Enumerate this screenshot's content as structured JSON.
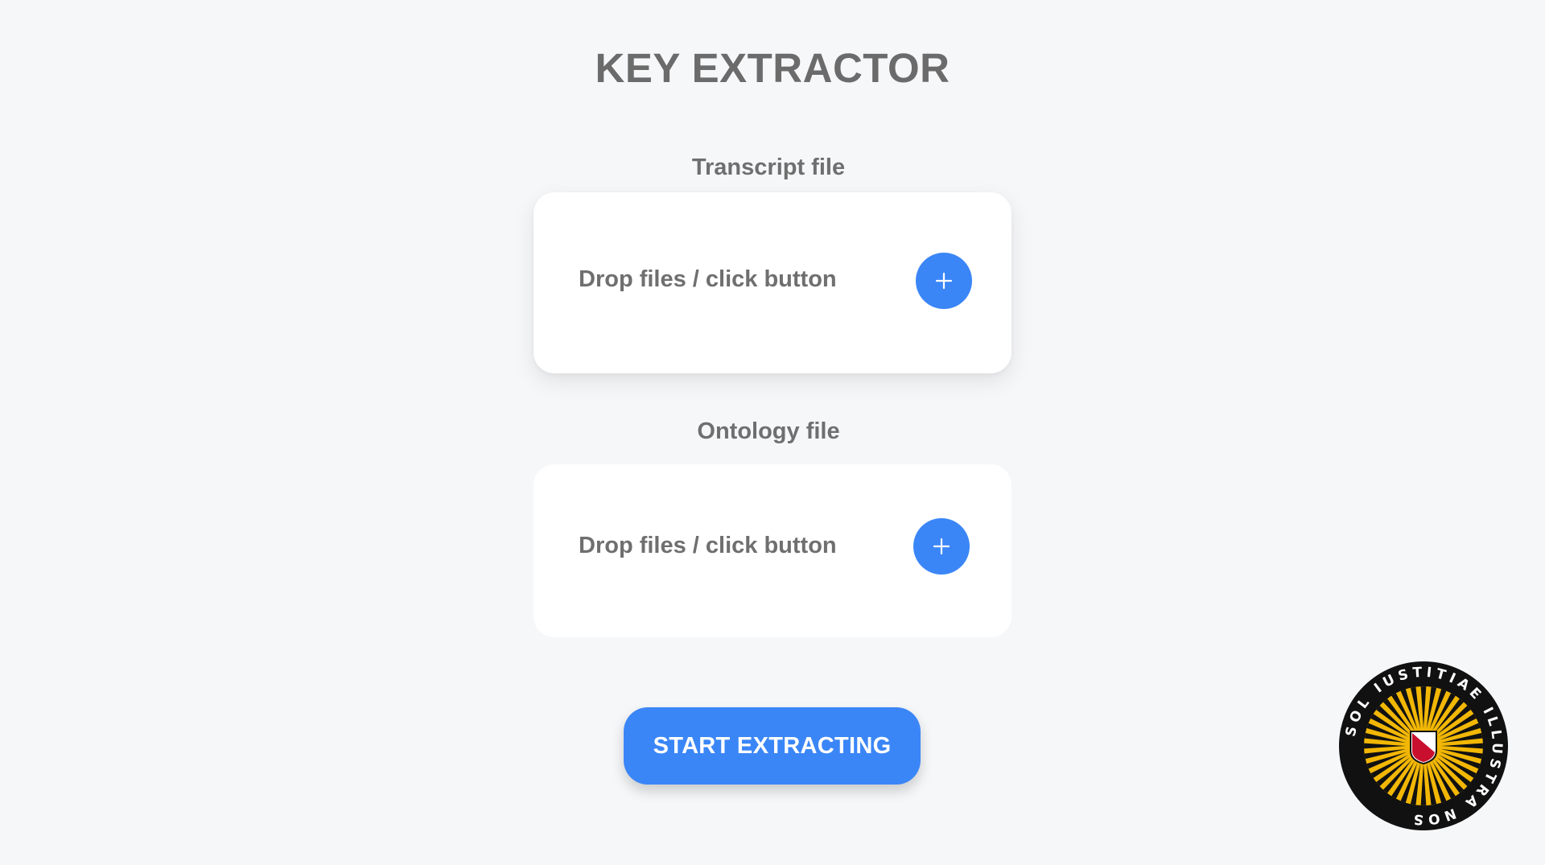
{
  "app": {
    "title": "KEY EXTRACTOR"
  },
  "transcript": {
    "label": "Transcript file",
    "drop_text": "Drop files / click button",
    "add_icon": "plus-icon"
  },
  "ontology": {
    "label": "Ontology file",
    "drop_text": "Drop files / click button",
    "add_icon": "plus-icon"
  },
  "actions": {
    "start_label": "START EXTRACTING"
  },
  "logo": {
    "name": "university-seal",
    "text": "SOL IUSTITIAE ILLUSTRA NOS",
    "colors": {
      "ring": "#111111",
      "rays": "#f2b705",
      "shield_red": "#c8102e"
    }
  },
  "colors": {
    "background": "#f6f7f9",
    "accent": "#3b86f7",
    "text": "#6b6b6b",
    "card": "#ffffff"
  }
}
